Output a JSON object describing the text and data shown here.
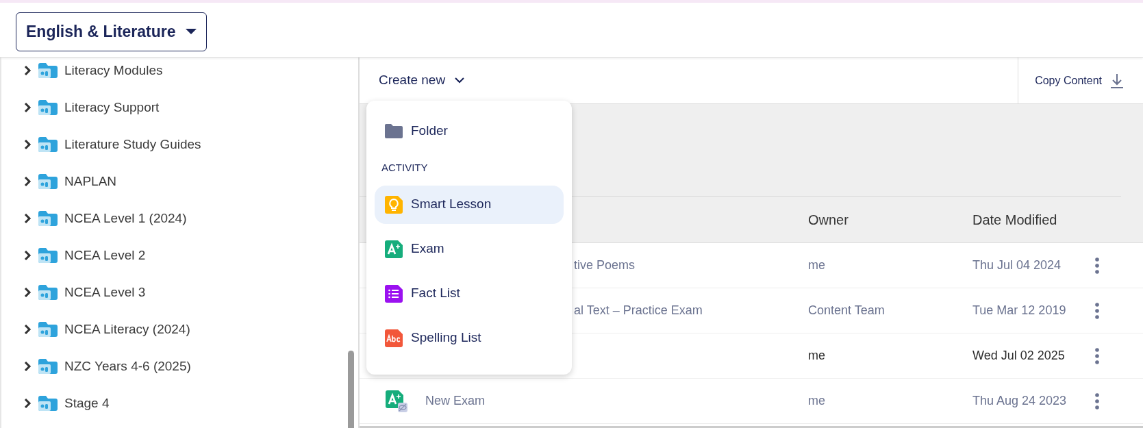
{
  "subject_selector": {
    "label": "English & Literature"
  },
  "sidebar": {
    "items": [
      {
        "label": "Literacy Modules",
        "expanded": false
      },
      {
        "label": "Literacy Support",
        "expanded": false
      },
      {
        "label": "Literature Study Guides",
        "expanded": false
      },
      {
        "label": "NAPLAN",
        "expanded": false
      },
      {
        "label": "NCEA Level 1 (2024)",
        "expanded": false
      },
      {
        "label": "NCEA Level 2",
        "expanded": false
      },
      {
        "label": "NCEA Level 3",
        "expanded": false
      },
      {
        "label": "NCEA Literacy (2024)",
        "expanded": false
      },
      {
        "label": "NZC Years 4-6 (2025)",
        "expanded": false
      },
      {
        "label": "Stage 4",
        "expanded": false
      }
    ]
  },
  "toolbar": {
    "create_button": "Create new",
    "copy_button": "Copy Content"
  },
  "create_menu": {
    "items": [
      {
        "kind": "folder",
        "label": "Folder",
        "selected": false
      },
      {
        "kind": "header",
        "label": "ACTIVITY"
      },
      {
        "kind": "lesson",
        "label": "Smart Lesson",
        "selected": true
      },
      {
        "kind": "exam",
        "label": "Exam",
        "selected": false
      },
      {
        "kind": "factlist",
        "label": "Fact List",
        "selected": false
      },
      {
        "kind": "spelling",
        "label": "Spelling List",
        "selected": false
      }
    ]
  },
  "table": {
    "columns": [
      "Owner",
      "Date Modified"
    ],
    "rows": [
      {
        "name": "tive Poems",
        "owner": "me",
        "date": "Thu Jul 04 2024",
        "highlighted": false
      },
      {
        "name": "al Text – Practice Exam",
        "owner": "Content Team",
        "date": "Tue Mar 12 2019",
        "highlighted": false
      },
      {
        "owner": "me",
        "date": "Wed Jul 02 2025",
        "highlighted": true
      },
      {
        "kind": "exam",
        "hidden": true,
        "name": "New Exam",
        "owner": "me",
        "date": "Thu Aug 24 2023",
        "highlighted": false
      }
    ]
  }
}
